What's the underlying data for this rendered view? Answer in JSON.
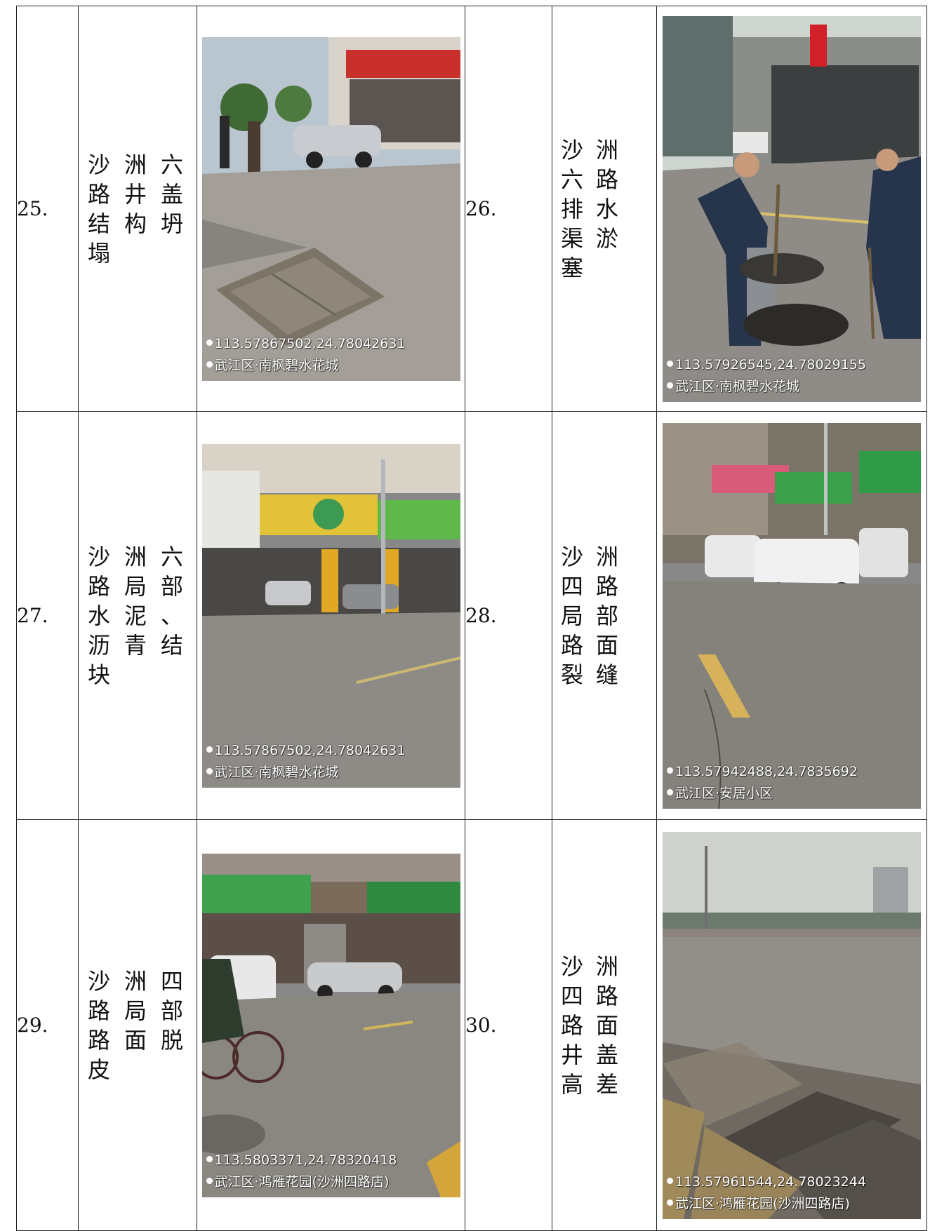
{
  "rows": [
    {
      "left": {
        "number": "25.",
        "description": "沙洲六路井盖结构坍塌",
        "photo": {
          "scene": "manhole-cover-sidewalk",
          "coordinates": "113.57867502,24.78042631",
          "location": "武江区·南枫碧水花城"
        }
      },
      "right": {
        "number": "26.",
        "description": "沙洲六路排水渠淤塞",
        "photo": {
          "scene": "workers-drain-cleaning",
          "coordinates": "113.57926545,24.78029155",
          "location": "武江区·南枫碧水花城"
        }
      }
    },
    {
      "left": {
        "number": "27.",
        "description": "沙洲六路局部水泥、沥青结块",
        "photo": {
          "scene": "storefront-street",
          "coordinates": "113.57867502,24.78042631",
          "location": "武江区·南枫碧水花城"
        }
      },
      "right": {
        "number": "28.",
        "description": "沙洲四路局部路面裂缝",
        "photo": {
          "scene": "street-parked-vans",
          "coordinates": "113.57942488,24.7835692",
          "location": "武江区·安居小区"
        }
      }
    },
    {
      "left": {
        "number": "29.",
        "description": "沙洲四路局部路面脱皮",
        "photo": {
          "scene": "street-shops-bicycle",
          "coordinates": "113.5803371,24.78320418",
          "location": "武江区·鸿雁花园(沙洲四路店)"
        }
      },
      "right": {
        "number": "30.",
        "description": "沙洲四路路面井盖高差",
        "photo": {
          "scene": "manhole-covers-pavement",
          "coordinates": "113.57961544,24.78023244",
          "location": "武江区·鸿雁花园(沙洲四路店)"
        }
      }
    }
  ]
}
